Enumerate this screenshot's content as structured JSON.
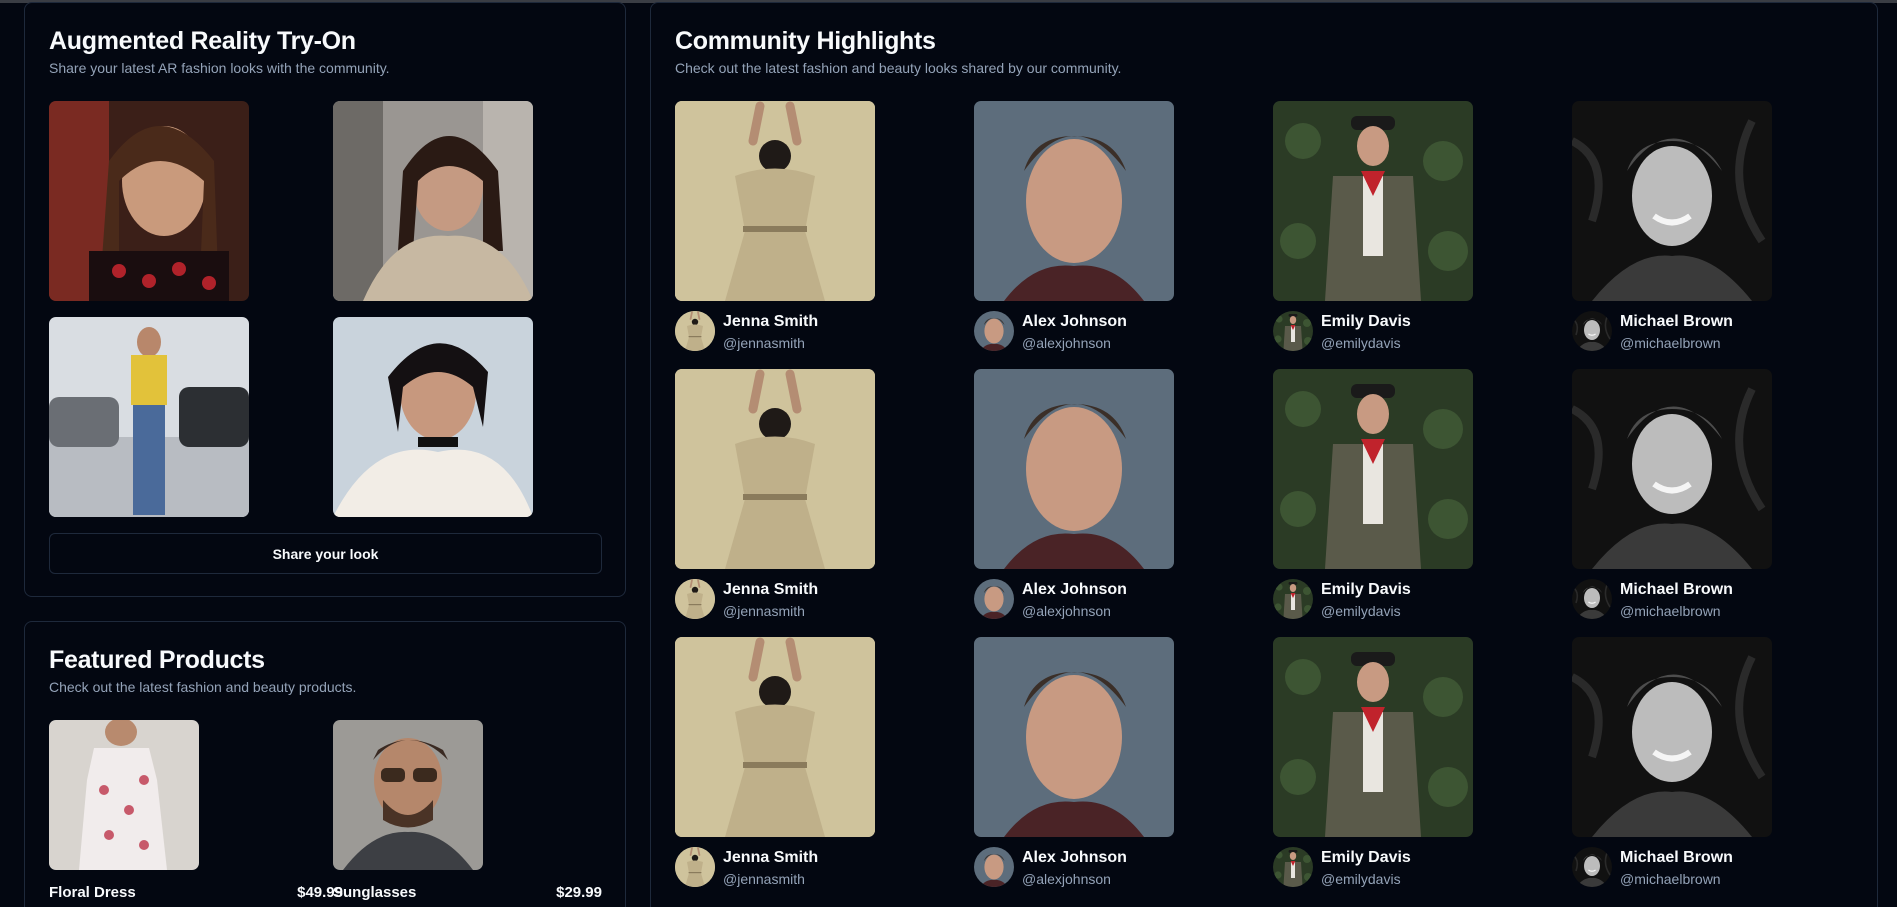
{
  "ar_tryon": {
    "title": "Augmented Reality Try-On",
    "subtitle": "Share your latest AR fashion looks with the community.",
    "share_label": "Share your look"
  },
  "featured": {
    "title": "Featured Products",
    "subtitle": "Check out the latest fashion and beauty products.",
    "products": [
      {
        "name": "Floral Dress",
        "price": "$49.99"
      },
      {
        "name": "Sunglasses",
        "price": "$29.99"
      }
    ]
  },
  "community": {
    "title": "Community Highlights",
    "subtitle": "Check out the latest fashion and beauty looks shared by our community.",
    "users": [
      {
        "name": "Jenna Smith",
        "handle": "@jennasmith"
      },
      {
        "name": "Alex Johnson",
        "handle": "@alexjohnson"
      },
      {
        "name": "Emily Davis",
        "handle": "@emilydavis"
      },
      {
        "name": "Michael Brown",
        "handle": "@michaelbrown"
      }
    ]
  },
  "colors": {
    "background": "#030711",
    "border": "#1e293b",
    "muted_text": "#94a3b8",
    "text": "#f8fafc"
  }
}
